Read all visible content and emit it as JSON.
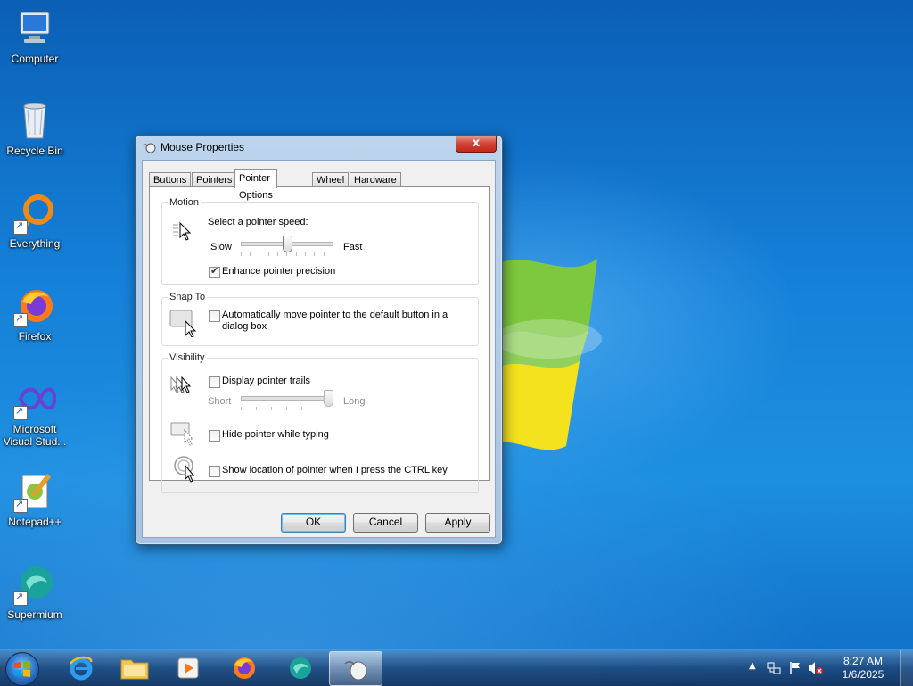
{
  "desktop": {
    "icons": [
      {
        "label": "Computer"
      },
      {
        "label": "Recycle Bin"
      },
      {
        "label": "Everything"
      },
      {
        "label": "Firefox"
      },
      {
        "label": "Microsoft Visual Stud..."
      },
      {
        "label": "Notepad++"
      },
      {
        "label": "Supermium"
      }
    ]
  },
  "dialog": {
    "title": "Mouse Properties",
    "close_label": "x",
    "tabs": [
      {
        "label": "Buttons"
      },
      {
        "label": "Pointers"
      },
      {
        "label": "Pointer Options",
        "active": true
      },
      {
        "label": "Wheel"
      },
      {
        "label": "Hardware"
      }
    ],
    "motion": {
      "title": "Motion",
      "speed_label": "Select a pointer speed:",
      "slow_label": "Slow",
      "fast_label": "Fast",
      "speed_value": 0.5,
      "enhance_label": "Enhance pointer precision",
      "enhance_checked": true
    },
    "snap": {
      "title": "Snap To",
      "auto_move_label": "Automatically move pointer to the default button in a dialog box",
      "auto_move_checked": false
    },
    "visibility": {
      "title": "Visibility",
      "trails_label": "Display pointer trails",
      "trails_checked": false,
      "short_label": "Short",
      "long_label": "Long",
      "trails_value": 1.0,
      "hide_label": "Hide pointer while typing",
      "hide_checked": false,
      "ctrl_label": "Show location of pointer when I press the CTRL key",
      "ctrl_checked": false
    },
    "buttons": {
      "ok": "OK",
      "cancel": "Cancel",
      "apply": "Apply"
    }
  },
  "taskbar": {
    "pinned": [
      "start-orb",
      "internet-explorer",
      "file-explorer",
      "media-player",
      "firefox",
      "supermium",
      "mouse-properties"
    ],
    "clock_time": "8:27 AM",
    "clock_date": "1/6/2025"
  },
  "colors": {
    "accent": "#1580d8",
    "close_red": "#c3271a",
    "default_button": "#3c7fb1"
  }
}
